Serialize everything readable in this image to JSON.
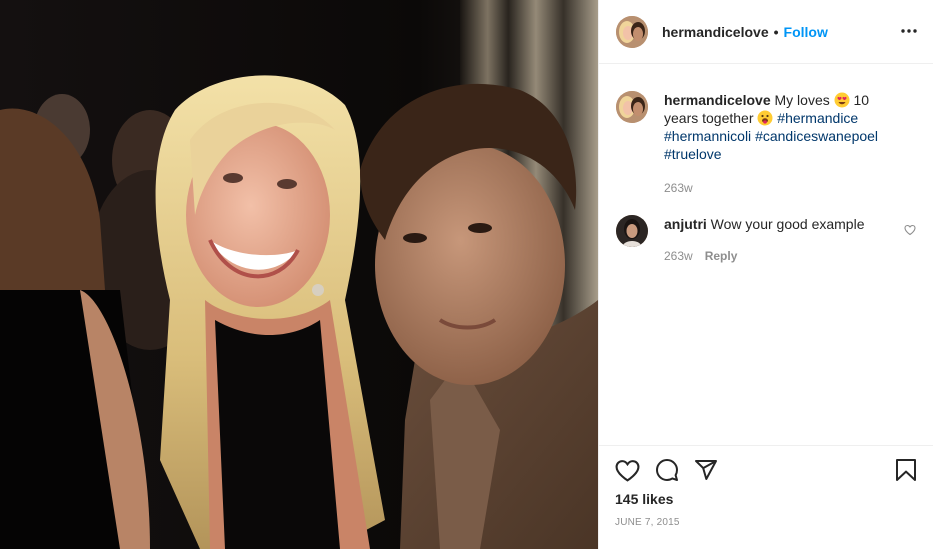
{
  "post": {
    "photo_description": "",
    "username": "hermandicelove",
    "follow_label": "Follow",
    "header_separator": "•"
  },
  "caption": {
    "username": "hermandicelove",
    "text_before_emoji1": "My loves",
    "emoji1": "heart-eyes-emoji",
    "text_before_emoji2": "10 years together",
    "emoji2": "tongue-out-emoji",
    "hashtags": [
      "#hermandice",
      "#hermannicoli",
      "#candiceswanepoel",
      "#truelove"
    ],
    "time": "263w"
  },
  "comments": [
    {
      "username": "anjutri",
      "text": "Wow your good example",
      "time": "263w",
      "reply_label": "Reply"
    }
  ],
  "actions": {
    "icons": [
      "heart-icon",
      "comment-icon",
      "share-icon",
      "bookmark-icon"
    ]
  },
  "likes_label": "145 likes",
  "date_label": "JUNE 7, 2015",
  "colors": {
    "follow_blue": "#0095f6",
    "hashtag_blue": "#00376b",
    "muted_gray": "#8e8e8e",
    "text_dark": "#262626",
    "divider": "#efefef"
  }
}
